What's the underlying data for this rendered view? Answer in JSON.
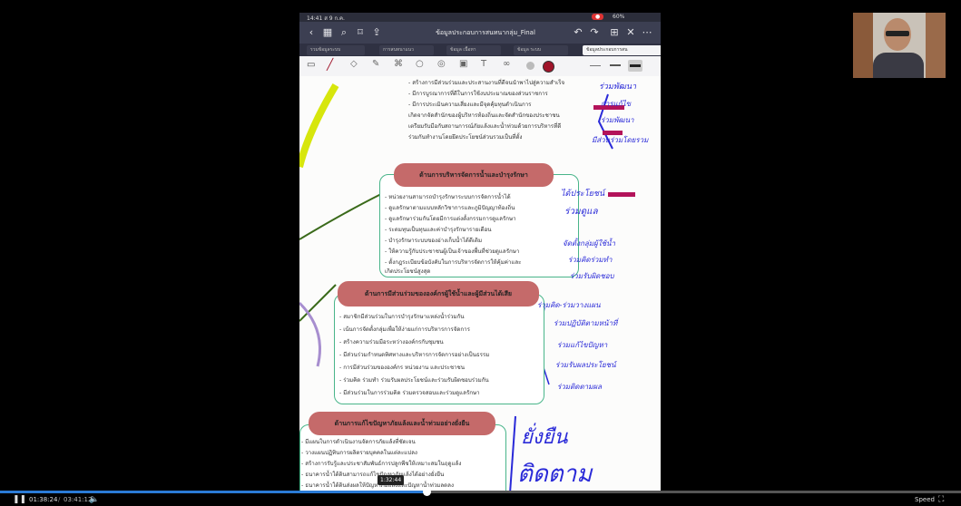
{
  "tablet": {
    "status": {
      "time": "14:41 ส 9 ก.ค.",
      "battery": "60%"
    },
    "doc_title": "ข้อมูลประกอบการสนทนากลุ่ม_Final",
    "tabs": [
      "รวมข้อมูลระบบ",
      "การสนทนาแนว",
      "ข้อมูล เนื้อหา",
      "ข้อมูล ระบบ",
      "ข้อมูลประกอบการสน"
    ]
  },
  "doc": {
    "top_items": [
      "- สร้างการมีส่วนร่วมและประสานงานที่ดีจนนำพาไปสู่ความสำเร็จ",
      "- มีการบูรณาการที่ดีในการใช้งบประมาณของส่วนราชการ",
      "- มีการประเมินความเสี่ยงและมีจุดคุ้มทุนดำเนินการ",
      "  เกิดจากจัดสำนักของผู้บริหารท้องถิ่นและจัดสำนักของประชาชน",
      "  เตรียมรับมือกับสถานการณ์ภัยแล้งและน้ำท่วมด้วยการบริหารที่ดี",
      "  ร่วมกันทำงานโดยยึดประโยชน์ส่วนรวมเป็นที่ตั้ง"
    ],
    "section2_title": "ด้านการบริหารจัดการน้ำและบำรุงรักษา",
    "section2_items": [
      "- หน่วยงานสามารถบำรุงรักษาระบบการจัดการน้ำได้",
      "- ดูแลรักษาตามแบบหลักวิชาการและภูมิปัญญาท้องถิ่น",
      "- ดูแลรักษาร่วมกันโดยมีการแต่งตั้งกรรมการดูแลรักษา",
      "- ระดมทุนเป็นทุนและค่าบำรุงรักษารายเดือน",
      "- บำรุงรักษาระบบของอ่างเก็บน้ำได้ดีเดิม",
      "- ให้ความรู้กับประชาชนผู้เป็นเจ้าของพื้นที่ช่วยดูแลรักษา",
      "- ตั้งกฎระเบียบข้อบังคับในการบริหารจัดการให้คุ้มค่าและ",
      "  เกิดประโยชน์สูงสุด"
    ],
    "section3_title": "ด้านการมีส่วนร่วมขององค์กรผู้ใช้น้ำและผู้มีส่วนได้เสีย",
    "section3_items": [
      "- สมาชิกมีส่วนร่วมในการบำรุงรักษาแหล่งน้ำร่วมกัน",
      "- เน้นการจัดตั้งกลุ่มเพื่อให้ง่ายแก่การบริหารการจัดการ",
      "- สร้างความร่วมมือระหว่างองค์กรกับชุมชน",
      "- มีส่วนร่วมกำหนดทิศทางและบริหารการจัดการอย่างเป็นธรรม",
      "- การมีส่วนร่วมขององค์กร หน่วยงาน และประชาชน",
      "- ร่วมคิด ร่วมทำ ร่วมรับผลประโยชน์และร่วมรับผิดชอบร่วมกัน",
      "- มีส่วนร่วมในการร่วมคิด ร่วมตรวจสอบและร่วมดูแลรักษา"
    ],
    "section4_title": "ด้านการแก้ไขปัญหาภัยแล้งและน้ำท่วมอย่างยั่งยืน",
    "section4_items": [
      "- มีแผนในการดำเนินงานจัดการภัยแล้งที่ชัดเจน",
      "- วางแผนปฏิทินการผลิตรายบุคคลในแต่ละแปลง",
      "- สร้างการรับรู้และประชาสัมพันธ์การปลูกพืชให้เหมาะสมในฤดูแล้ง",
      "- ธนาคารน้ำใต้ดินสามารถแก้ไขปัญหาภัยแล้งได้อย่างยั่งยืน",
      "- ธนาคารน้ำใต้ดินส่งผลให้ปัญหาภัยแล้งและปัญหาน้ำท่วมลดลง"
    ],
    "handwriting": {
      "n1": "ร่วมพัฒนา",
      "n2": "การแก้ไข",
      "n3": "ร่วมพัฒนา",
      "n4": "มีส่วนร่วมโดยรวม",
      "n5": "ได้ประโยชน์",
      "n6": "ร่วมดูแล",
      "n7": "จัดตั้งกลุ่มผู้ใช้น้ำ",
      "n8": "ร่วมคิดร่วมทำ",
      "n9": "ร่วมรับผิดชอบ",
      "n10": "ร่วมคิด-ร่วมวางแผน",
      "n11": "ร่วมปฏิบัติตามหน้าที่",
      "n12": "ร่วมแก้ไขปัญหา",
      "n13": "ร่วมรับผลประโยชน์",
      "n14": "ร่วมติดตามผล",
      "n15": "ยั่งยืน",
      "n16": "ติดตาม"
    }
  },
  "player": {
    "current_time": "01:38:24",
    "duration": "03:41:12",
    "hover_time": "1:32:44",
    "progress": 0.444,
    "speed_label": "Speed"
  },
  "colors": {
    "accent": "#2a7bd6",
    "section": "#c56a6a",
    "box_border": "#49b58a",
    "pen": "#2a2ad8"
  }
}
